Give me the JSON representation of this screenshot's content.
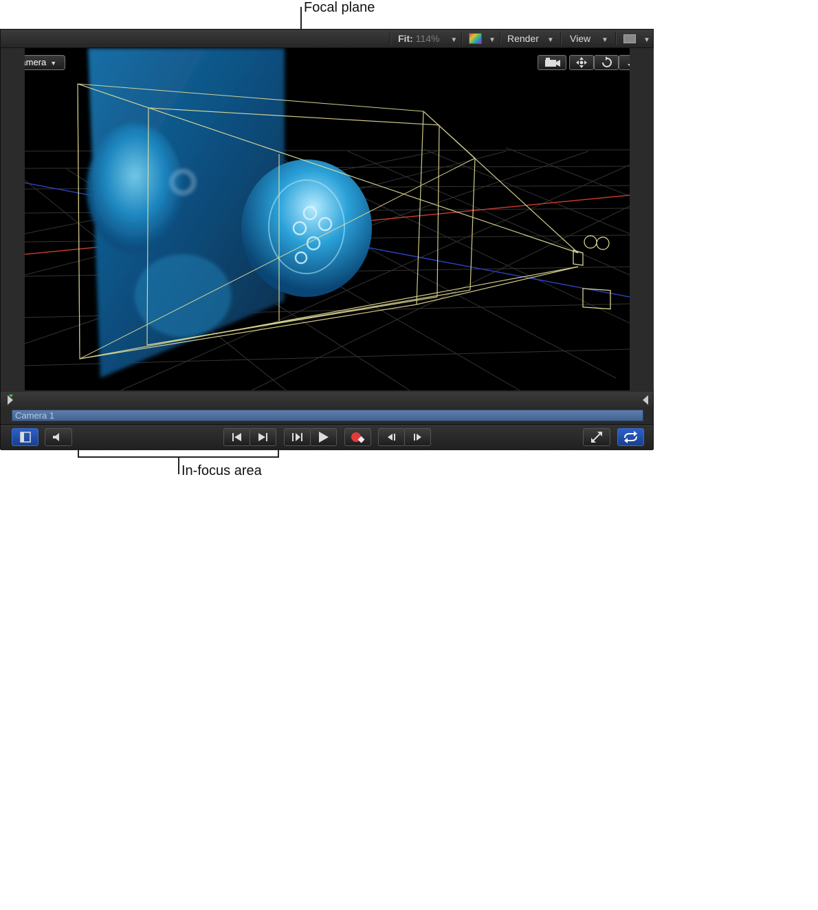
{
  "callouts": {
    "focal_plane": "Focal plane",
    "in_focus_area": "In-focus area"
  },
  "toolbar": {
    "fit_label": "Fit:",
    "fit_value": "114%",
    "render_label": "Render",
    "view_label": "View",
    "dropdown_glyph": "▼"
  },
  "viewport": {
    "camera_menu_label": "Camera",
    "tools": [
      "camera-icon",
      "pan-icon",
      "orbit-icon",
      "dolly-icon"
    ],
    "axis_colors": {
      "x": "#c23a2a",
      "z": "#2c3fb8"
    },
    "wireframe_color": "#e8e29a"
  },
  "timeline": {
    "layer_name": "Camera 1"
  },
  "transport": {
    "buttons": [
      "show-hide-pane-icon",
      "mute-icon",
      "go-to-start-icon",
      "go-to-end-icon",
      "play-from-start-icon",
      "play-icon",
      "record-icon",
      "previous-frame-icon",
      "next-frame-icon",
      "full-screen-icon",
      "loop-icon"
    ]
  }
}
